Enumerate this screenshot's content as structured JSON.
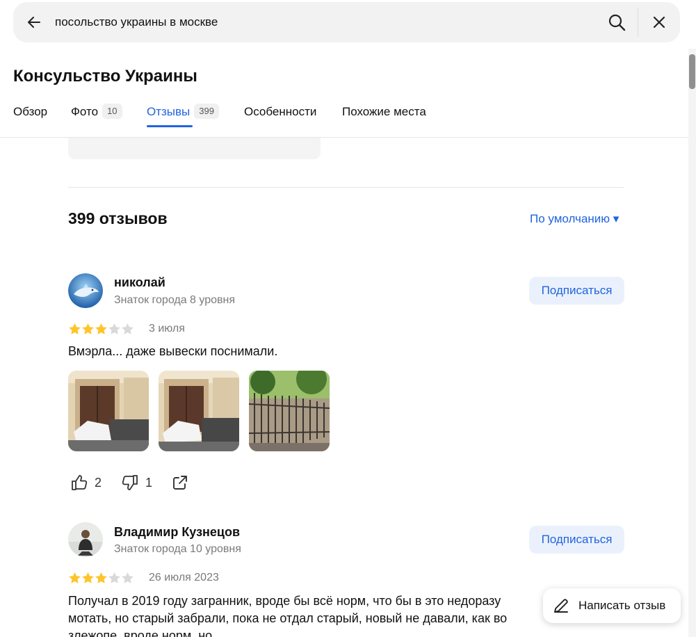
{
  "search": {
    "query": "посольство украины в москве"
  },
  "place": {
    "title": "Консульство Украины"
  },
  "tabs": [
    {
      "label": "Обзор",
      "count": ""
    },
    {
      "label": "Фото",
      "count": "10"
    },
    {
      "label": "Отзывы",
      "count": "399",
      "active": true
    },
    {
      "label": "Особенности",
      "count": ""
    },
    {
      "label": "Похожие места",
      "count": ""
    }
  ],
  "reviews_header": {
    "count_text": "399 отзывов",
    "sort_label": "По умолчанию ▾"
  },
  "reviews": [
    {
      "author": "николай",
      "level": "Знаток города 8 уровня",
      "subscribe_label": "Подписаться",
      "rating": 3,
      "max_rating": 5,
      "date": "3 июля",
      "text": "Вмэрла... даже вывески поснимали.",
      "likes": "2",
      "dislikes": "1"
    },
    {
      "author": "Владимир Кузнецов",
      "level": "Знаток города 10 уровня",
      "subscribe_label": "Подписаться",
      "rating": 3,
      "max_rating": 5,
      "date": "26 июля 2023",
      "text_lines": [
        "Получал в 2019 году загранник, вроде бы всё норм, что бы в это недоразу",
        "мотать, но старый забрали, пока не отдал старый, новый не давали, как во",
        "злежопе, вроде норм, но"
      ]
    }
  ],
  "write_review": {
    "label": "Написать отзыв"
  },
  "colors": {
    "accent": "#1f64e0",
    "star_filled": "#fdc52a",
    "star_empty": "#d9d9d9",
    "subscribe_bg": "#ebf1fc"
  }
}
